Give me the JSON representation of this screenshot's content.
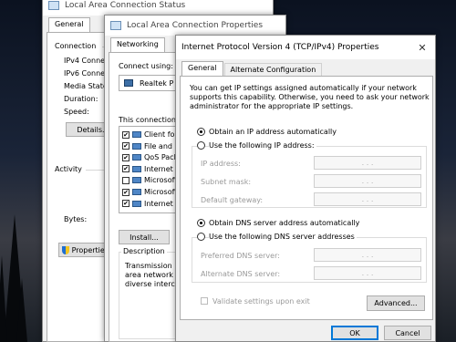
{
  "win1": {
    "title": "Local Area Connection Status",
    "tab": "General",
    "connection_heading": "Connection",
    "rows": [
      "IPv4 Connect",
      "IPv6 Connect",
      "Media State:",
      "Duration:",
      "Speed:"
    ],
    "details_button": "Details...",
    "activity_heading": "Activity",
    "bytes_label": "Bytes:",
    "properties_button": "Properties"
  },
  "win2": {
    "title": "Local Area Connection Properties",
    "tab": "Networking",
    "connect_using": "Connect using:",
    "adapter": "Realtek P",
    "uses_text": "This connection u",
    "items": [
      {
        "label": "Client for",
        "checked": true
      },
      {
        "label": "File and P",
        "checked": true
      },
      {
        "label": "QoS Pack",
        "checked": true
      },
      {
        "label": "Internet P",
        "checked": true
      },
      {
        "label": "Microsoft",
        "checked": false
      },
      {
        "label": "Microsoft",
        "checked": true
      },
      {
        "label": "Internet P",
        "checked": true
      }
    ],
    "install_button": "Install...",
    "description_heading": "Description",
    "description_lines": [
      "Transmission",
      "area network p",
      "diverse interco"
    ]
  },
  "win3": {
    "title": "Internet Protocol Version 4 (TCP/IPv4) Properties",
    "tabs": [
      "General",
      "Alternate Configuration"
    ],
    "intro_lines": [
      "You can get IP settings assigned automatically if your network",
      "supports this capability. Otherwise, you need to ask your network",
      "administrator for the appropriate IP settings."
    ],
    "radio_auto_ip": "Obtain an IP address automatically",
    "radio_manual_ip": "Use the following IP address:",
    "ip_label": "IP address:",
    "subnet_label": "Subnet mask:",
    "gateway_label": "Default gateway:",
    "radio_auto_dns": "Obtain DNS server address automatically",
    "radio_manual_dns": "Use the following DNS server addresses",
    "preferred_dns_label": "Preferred DNS server:",
    "alternate_dns_label": "Alternate DNS server:",
    "validate_label": "Validate settings upon exit",
    "advanced_button": "Advanced...",
    "ok_button": "OK",
    "cancel_button": "Cancel",
    "ip_dots": ". . ."
  },
  "colors": {
    "accent": "#0078d7",
    "disabled_text": "#9a9a9a"
  }
}
